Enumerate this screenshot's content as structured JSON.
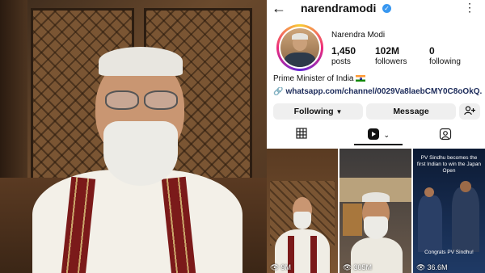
{
  "profile": {
    "username": "narendramodi",
    "full_name": "Narendra Modi",
    "stats": [
      {
        "value": "1,450",
        "label": "posts"
      },
      {
        "value": "102M",
        "label": "followers"
      },
      {
        "value": "0",
        "label": "following"
      }
    ],
    "bio": "Prime Minister of India",
    "link": "whatsapp.com/channel/0029Va8laebCMY0C8oOkQ..."
  },
  "buttons": {
    "following": "Following",
    "message": "Message"
  },
  "icons": {
    "back": "arrow-left-icon",
    "verified": "verified-badge-icon",
    "more": "more-vertical-icon",
    "link": "link-icon",
    "add_user": "add-person-icon",
    "grid": "grid-icon",
    "reels": "reels-icon",
    "tagged": "tagged-icon",
    "views": "eye-icon"
  },
  "reels": [
    {
      "views": "9M"
    },
    {
      "views": "305M"
    },
    {
      "views": "36.6M",
      "caption": "PV Sindhu becomes the first Indian to win the Japan Open",
      "caption_bottom": "Congrats PV Sindhu!"
    }
  ],
  "colors": {
    "verified": "#3897f0",
    "link_text": "#1c2b5a",
    "button_bg": "#efefef"
  }
}
